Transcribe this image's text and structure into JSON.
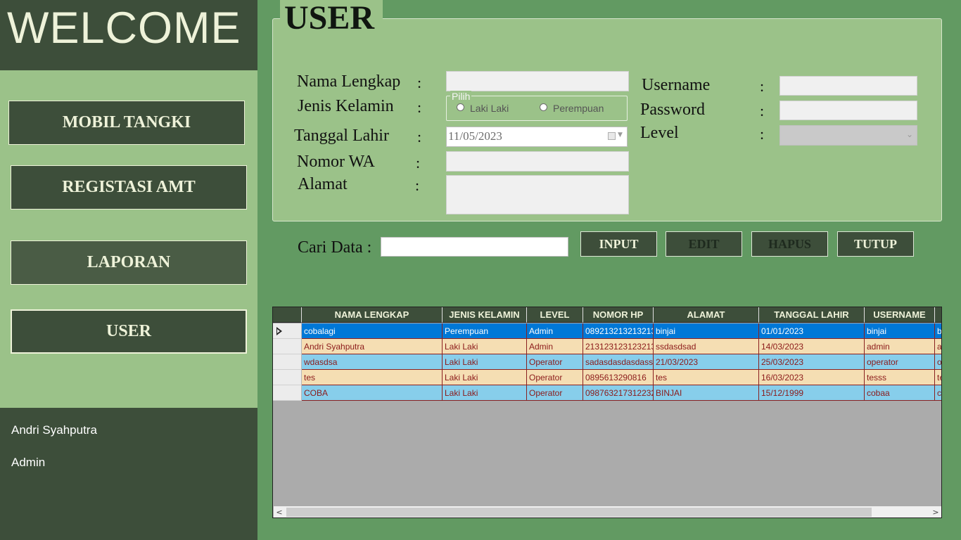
{
  "sidebar": {
    "welcome": "WELCOME",
    "nav": [
      "MOBIL TANGKI",
      "REGISTASI AMT",
      "LAPORAN",
      "USER"
    ],
    "user_name": "Andri Syahputra",
    "user_level": "Admin"
  },
  "form": {
    "title": "USER",
    "labels": {
      "nama": "Nama Lengkap",
      "jenis": "Jenis Kelamin",
      "tanggal": "Tanggal Lahir",
      "nomor": "Nomor WA",
      "alamat": "Alamat",
      "username": "Username",
      "password": "Password",
      "level": "Level"
    },
    "colon": ":",
    "gender_group": "Pilih",
    "gender_options": [
      "Laki Laki",
      "Perempuan"
    ],
    "tanggal_value": "11/05/2023"
  },
  "actions": {
    "search_label": "Cari Data :",
    "buttons": [
      "INPUT",
      "EDIT",
      "HAPUS",
      "TUTUP"
    ]
  },
  "table": {
    "columns": [
      "NAMA LENGKAP",
      "JENIS KELAMIN",
      "LEVEL",
      "NOMOR HP",
      "ALAMAT",
      "TANGGAL LAHIR",
      "USERNAME"
    ],
    "rows": [
      [
        "cobalagi",
        "Perempuan",
        "Admin",
        "089213213213213",
        "binjai",
        "01/01/2023",
        "binjai",
        "b"
      ],
      [
        "Andri Syahputra",
        "Laki Laki",
        "Admin",
        "213123123123213",
        "ssdasdsad",
        "14/03/2023",
        "admin",
        "a"
      ],
      [
        "wdasdsa",
        "Laki Laki",
        "Operator",
        "sadasdasdasdass",
        "21/03/2023",
        "25/03/2023",
        "operator",
        "o"
      ],
      [
        "tes",
        "Laki Laki",
        "Operator",
        "0895613290816",
        "tes",
        "16/03/2023",
        "tesss",
        "te"
      ],
      [
        "COBA",
        "Laki Laki",
        "Operator",
        "098763217312232",
        "BINJAI",
        "15/12/1999",
        "cobaa",
        "c"
      ]
    ]
  },
  "colors": {
    "dark_green": "#3d4e3a",
    "light_green": "#9bc289",
    "mid_green": "#629a62",
    "selected_row": "#0078d7",
    "peach_row": "#f5deb3",
    "blue_row": "#87ceeb"
  },
  "icons": {
    "calendar": "calendar-icon",
    "row_indicator": "current-row-indicator-icon",
    "scroll_left": "chevron-left-icon",
    "scroll_right": "chevron-right-icon"
  }
}
